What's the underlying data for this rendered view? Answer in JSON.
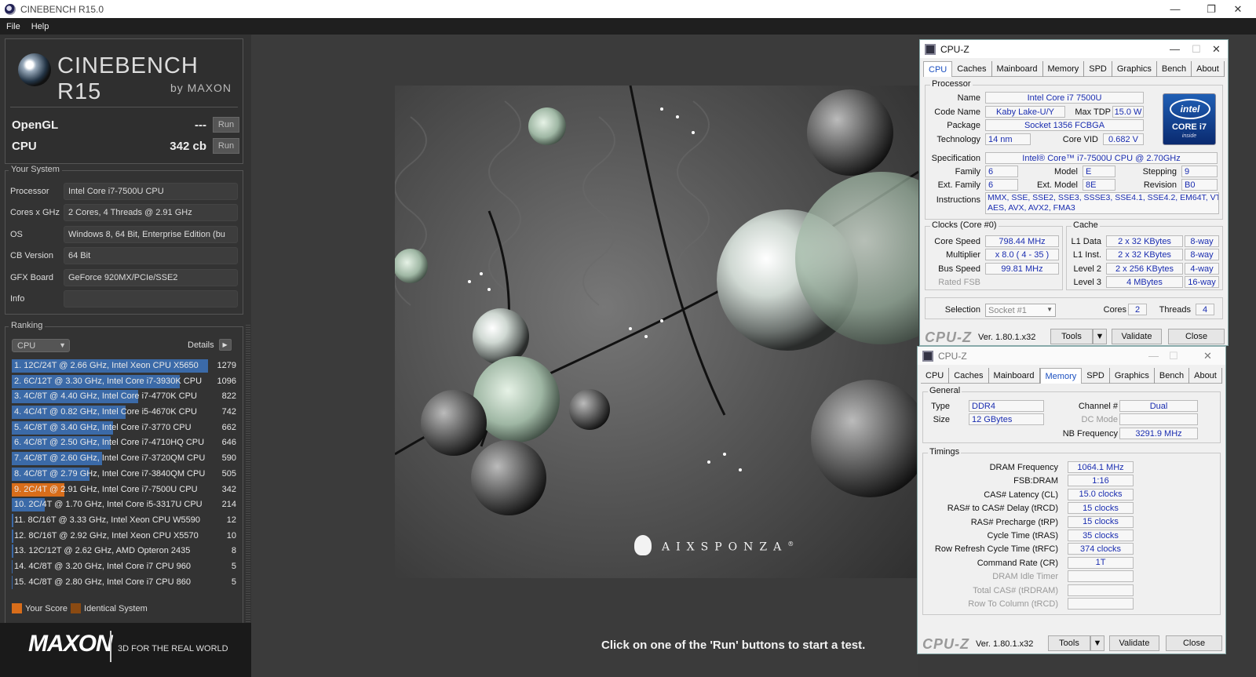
{
  "window": {
    "title": "CINEBENCH R15.0",
    "minimize": "—",
    "maximize": "❐",
    "close": "✕"
  },
  "menu": [
    "File",
    "Help"
  ],
  "logo": {
    "title": "CINEBENCH R15",
    "subtitle": "by MAXON"
  },
  "scores": [
    {
      "label": "OpenGL",
      "value": "---",
      "run": "Run"
    },
    {
      "label": "CPU",
      "value": "342 cb",
      "run": "Run"
    }
  ],
  "system": {
    "title": "Your System",
    "rows": [
      {
        "key": "Processor",
        "value": "Intel Core i7-7500U CPU"
      },
      {
        "key": "Cores x GHz",
        "value": "2 Cores, 4 Threads @ 2.91 GHz"
      },
      {
        "key": "OS",
        "value": "Windows 8, 64 Bit, Enterprise Edition (bu"
      },
      {
        "key": "CB Version",
        "value": "64 Bit"
      },
      {
        "key": "GFX Board",
        "value": "GeForce 920MX/PCIe/SSE2"
      },
      {
        "key": "Info",
        "value": ""
      }
    ]
  },
  "ranking": {
    "title": "Ranking",
    "select": "CPU",
    "details": "Details",
    "max_score": 1279,
    "items": [
      {
        "text": "1. 12C/24T @ 2.66 GHz, Intel Xeon CPU X5650",
        "score": 1279,
        "mine": false
      },
      {
        "text": "2. 6C/12T @ 3.30 GHz,  Intel Core i7-3930K CPU",
        "score": 1096,
        "mine": false
      },
      {
        "text": "3. 4C/8T @ 4.40 GHz, Intel Core i7-4770K CPU",
        "score": 822,
        "mine": false
      },
      {
        "text": "4. 4C/4T @ 0.82 GHz, Intel Core i5-4670K CPU",
        "score": 742,
        "mine": false
      },
      {
        "text": "5. 4C/8T @ 3.40 GHz,  Intel Core i7-3770 CPU",
        "score": 662,
        "mine": false
      },
      {
        "text": "6. 4C/8T @ 2.50 GHz, Intel Core i7-4710HQ CPU",
        "score": 646,
        "mine": false
      },
      {
        "text": "7. 4C/8T @ 2.60 GHz, Intel Core i7-3720QM CPU",
        "score": 590,
        "mine": false
      },
      {
        "text": "8. 4C/8T @ 2.79 GHz,  Intel Core i7-3840QM CPU",
        "score": 505,
        "mine": false
      },
      {
        "text": "9. 2C/4T @ 2.91 GHz, Intel Core i7-7500U CPU",
        "score": 342,
        "mine": true
      },
      {
        "text": "10. 2C/4T @ 1.70 GHz,  Intel Core i5-3317U CPU",
        "score": 214,
        "mine": false
      },
      {
        "text": "11. 8C/16T @ 3.33 GHz, Intel Xeon CPU W5590",
        "score": 12,
        "mine": false
      },
      {
        "text": "12. 8C/16T @ 2.92 GHz, Intel Xeon CPU X5570",
        "score": 10,
        "mine": false
      },
      {
        "text": "13. 12C/12T @ 2.62 GHz, AMD Opteron 2435",
        "score": 8,
        "mine": false
      },
      {
        "text": "14. 4C/8T @ 3.20 GHz, Intel Core i7 CPU 960",
        "score": 5,
        "mine": false
      },
      {
        "text": "15. 4C/8T @ 2.80 GHz, Intel Core i7 CPU 860",
        "score": 5,
        "mine": false
      }
    ],
    "legend": [
      {
        "label": "Your Score",
        "color": "#d86d1a"
      },
      {
        "label": "Identical System",
        "color": "#8a4a12"
      }
    ]
  },
  "footer": {
    "brand": "MAXON",
    "tagline": "3D FOR THE REAL WORLD"
  },
  "render": {
    "watermark": "AIXSPONZA",
    "registered": "®",
    "hint": "Click on one of the 'Run' buttons to start a test."
  },
  "colors": {
    "rank_bar": "#3b6aa8",
    "your_score": "#d86d1a",
    "identical": "#8a4a12"
  },
  "cpuz_cpu": {
    "title": "CPU-Z",
    "tabs": [
      "CPU",
      "Caches",
      "Mainboard",
      "Memory",
      "SPD",
      "Graphics",
      "Bench",
      "About"
    ],
    "active_tab": "CPU",
    "processor_title": "Processor",
    "name_label": "Name",
    "name": "Intel Core i7 7500U",
    "codename_label": "Code Name",
    "codename": "Kaby Lake-U/Y",
    "maxtdp_label": "Max TDP",
    "maxtdp": "15.0 W",
    "package_label": "Package",
    "package": "Socket 1356 FCBGA",
    "technology_label": "Technology",
    "technology": "14 nm",
    "corevid_label": "Core VID",
    "corevid": "0.682 V",
    "specification_label": "Specification",
    "specification": "Intel® Core™ i7-7500U CPU @ 2.70GHz",
    "family_label": "Family",
    "family": "6",
    "model_label": "Model",
    "model": "E",
    "stepping_label": "Stepping",
    "stepping": "9",
    "extfamily_label": "Ext. Family",
    "extfamily": "6",
    "extmodel_label": "Ext. Model",
    "extmodel": "8E",
    "revision_label": "Revision",
    "revision": "B0",
    "instructions_label": "Instructions",
    "instructions_1": "MMX, SSE, SSE2, SSE3, SSSE3, SSE4.1, SSE4.2, EM64T, VT-x,",
    "instructions_2": "AES, AVX, AVX2, FMA3",
    "intel_brand": "intel",
    "intel_model": "CORE i7",
    "intel_inside": "inside",
    "clocks_title": "Clocks (Core #0)",
    "corespeed_label": "Core Speed",
    "corespeed": "798.44 MHz",
    "multiplier_label": "Multiplier",
    "multiplier": "x 8.0 ( 4 - 35 )",
    "busspeed_label": "Bus Speed",
    "busspeed": "99.81 MHz",
    "ratedfsb_label": "Rated FSB",
    "cache_title": "Cache",
    "l1data_label": "L1 Data",
    "l1data": "2 x 32 KBytes",
    "l1data_way": "8-way",
    "l1inst_label": "L1 Inst.",
    "l1inst": "2 x 32 KBytes",
    "l1inst_way": "8-way",
    "level2_label": "Level 2",
    "level2": "2 x 256 KBytes",
    "level2_way": "4-way",
    "level3_label": "Level 3",
    "level3": "4 MBytes",
    "level3_way": "16-way",
    "selection_label": "Selection",
    "selection": "Socket #1",
    "cores_label": "Cores",
    "cores": "2",
    "threads_label": "Threads",
    "threads": "4",
    "logo": "CPU-Z",
    "version": "Ver. 1.80.1.x32",
    "tools": "Tools",
    "validate": "Validate",
    "close": "Close"
  },
  "cpuz_mem": {
    "title": "CPU-Z",
    "tabs": [
      "CPU",
      "Caches",
      "Mainboard",
      "Memory",
      "SPD",
      "Graphics",
      "Bench",
      "About"
    ],
    "active_tab": "Memory",
    "general_title": "General",
    "type_label": "Type",
    "type": "DDR4",
    "size_label": "Size",
    "size": "12 GBytes",
    "channel_label": "Channel #",
    "channel": "Dual",
    "dcmode_label": "DC Mode",
    "nbfreq_label": "NB Frequency",
    "nbfreq": "3291.9 MHz",
    "timings_title": "Timings",
    "timings": [
      {
        "label": "DRAM Frequency",
        "value": "1064.1 MHz",
        "dim": false
      },
      {
        "label": "FSB:DRAM",
        "value": "1:16",
        "dim": false
      },
      {
        "label": "CAS# Latency (CL)",
        "value": "15.0 clocks",
        "dim": false
      },
      {
        "label": "RAS# to CAS# Delay (tRCD)",
        "value": "15 clocks",
        "dim": false
      },
      {
        "label": "RAS# Precharge (tRP)",
        "value": "15 clocks",
        "dim": false
      },
      {
        "label": "Cycle Time (tRAS)",
        "value": "35 clocks",
        "dim": false
      },
      {
        "label": "Row Refresh Cycle Time (tRFC)",
        "value": "374 clocks",
        "dim": false
      },
      {
        "label": "Command Rate (CR)",
        "value": "1T",
        "dim": false
      },
      {
        "label": "DRAM Idle Timer",
        "value": "",
        "dim": true
      },
      {
        "label": "Total CAS# (tRDRAM)",
        "value": "",
        "dim": true
      },
      {
        "label": "Row To Column (tRCD)",
        "value": "",
        "dim": true
      }
    ],
    "logo": "CPU-Z",
    "version": "Ver. 1.80.1.x32",
    "tools": "Tools",
    "validate": "Validate",
    "close": "Close"
  }
}
